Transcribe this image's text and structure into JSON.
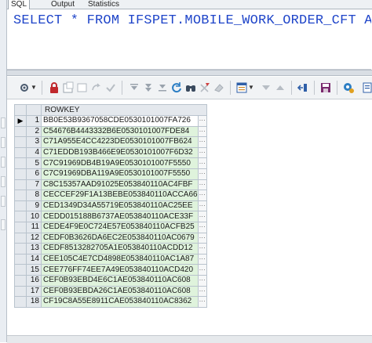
{
  "tabs": [
    "SQL",
    "Output",
    "Statistics"
  ],
  "editor": {
    "sql_text": "SELECT * FROM IFSPET.MOBILE_WORK_ORDER_CFT A"
  },
  "toolbar": {
    "icons": [
      "grid-options-icon",
      "lock-icon",
      "new-record-icon",
      "delete-record-icon",
      "cancel-icon",
      "post-changes-icon",
      "first-record-icon",
      "next-page-icon",
      "last-record-icon",
      "refresh-icon",
      "find-icon",
      "clear-icon",
      "clear-eraser-icon",
      "single-record-view-icon",
      "sort-desc-icon",
      "sort-asc-icon",
      "export-icon",
      "save-icon",
      "query-settings-icon",
      "more-icon"
    ]
  },
  "grid": {
    "column_header": "ROWKEY",
    "rows": [
      {
        "n": "1",
        "rowkey": "BB0E53B9367058CDE0530101007FA726"
      },
      {
        "n": "2",
        "rowkey": "C54676B4443332B6E0530101007FDE84"
      },
      {
        "n": "3",
        "rowkey": "C71A955E4CC4223DE0530101007FB624"
      },
      {
        "n": "4",
        "rowkey": "C71EDDB193B466E9E0530101007F6D32"
      },
      {
        "n": "5",
        "rowkey": "C7C91969DB4B19A9E0530101007F5550"
      },
      {
        "n": "6",
        "rowkey": "C7C91969DBA119A9E0530101007F5550"
      },
      {
        "n": "7",
        "rowkey": "C8C15357AAD91025E053840110AC4FBF"
      },
      {
        "n": "8",
        "rowkey": "CECCEF29F1A13BEBE053840110ACCA66"
      },
      {
        "n": "9",
        "rowkey": "CED1349D34A55719E053840110AC25EE"
      },
      {
        "n": "10",
        "rowkey": "CEDD015188B6737AE053840110ACE33F"
      },
      {
        "n": "11",
        "rowkey": "CEDE4F9E0C724E57E053840110ACFB25"
      },
      {
        "n": "12",
        "rowkey": "CEDF0B3626DA6EC2E053840110AC0679"
      },
      {
        "n": "13",
        "rowkey": "CEDF8513282705A1E053840110ACDD12"
      },
      {
        "n": "14",
        "rowkey": "CEE105C4E7CD4898E053840110AC1A87"
      },
      {
        "n": "15",
        "rowkey": "CEE776FF74EE7A49E053840110ACD420"
      },
      {
        "n": "16",
        "rowkey": "CEF0B93EBD4E6C1AE053840110AC608"
      },
      {
        "n": "17",
        "rowkey": "CEF0B93EBDA26C1AE053840110AC608"
      },
      {
        "n": "18",
        "rowkey": "CF19C8A55E8911CAE053840110AC8362"
      }
    ],
    "current_row_marker": "▶",
    "cell_button": "···"
  },
  "colors": {
    "sql_keyword": "#1f45c9",
    "row_fill": "#dff3dc",
    "header_fill": "#e4e8ed"
  }
}
